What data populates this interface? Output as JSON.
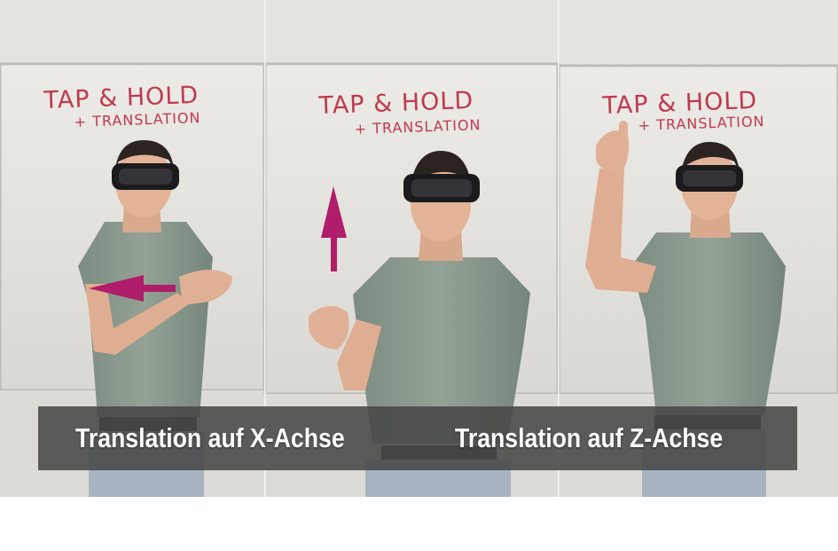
{
  "panels": [
    {
      "title": "TAP & HOLD",
      "subtitle": "+ TRANSLATION"
    },
    {
      "title": "TAP & HOLD",
      "subtitle": "+ TRANSLATION"
    },
    {
      "title": "TAP & HOLD",
      "subtitle": "+ TRANSLATION"
    }
  ],
  "captions": {
    "left": "Translation auf X-Achse",
    "right": "Translation auf Z-Achse"
  },
  "colors": {
    "arrow": "#b01d6a",
    "marker_text": "#c0394f",
    "caption_bar": "#484848"
  },
  "icons": {
    "panel1_arrow": "arrow-left-icon",
    "panel2_arrow": "arrow-up-icon"
  }
}
